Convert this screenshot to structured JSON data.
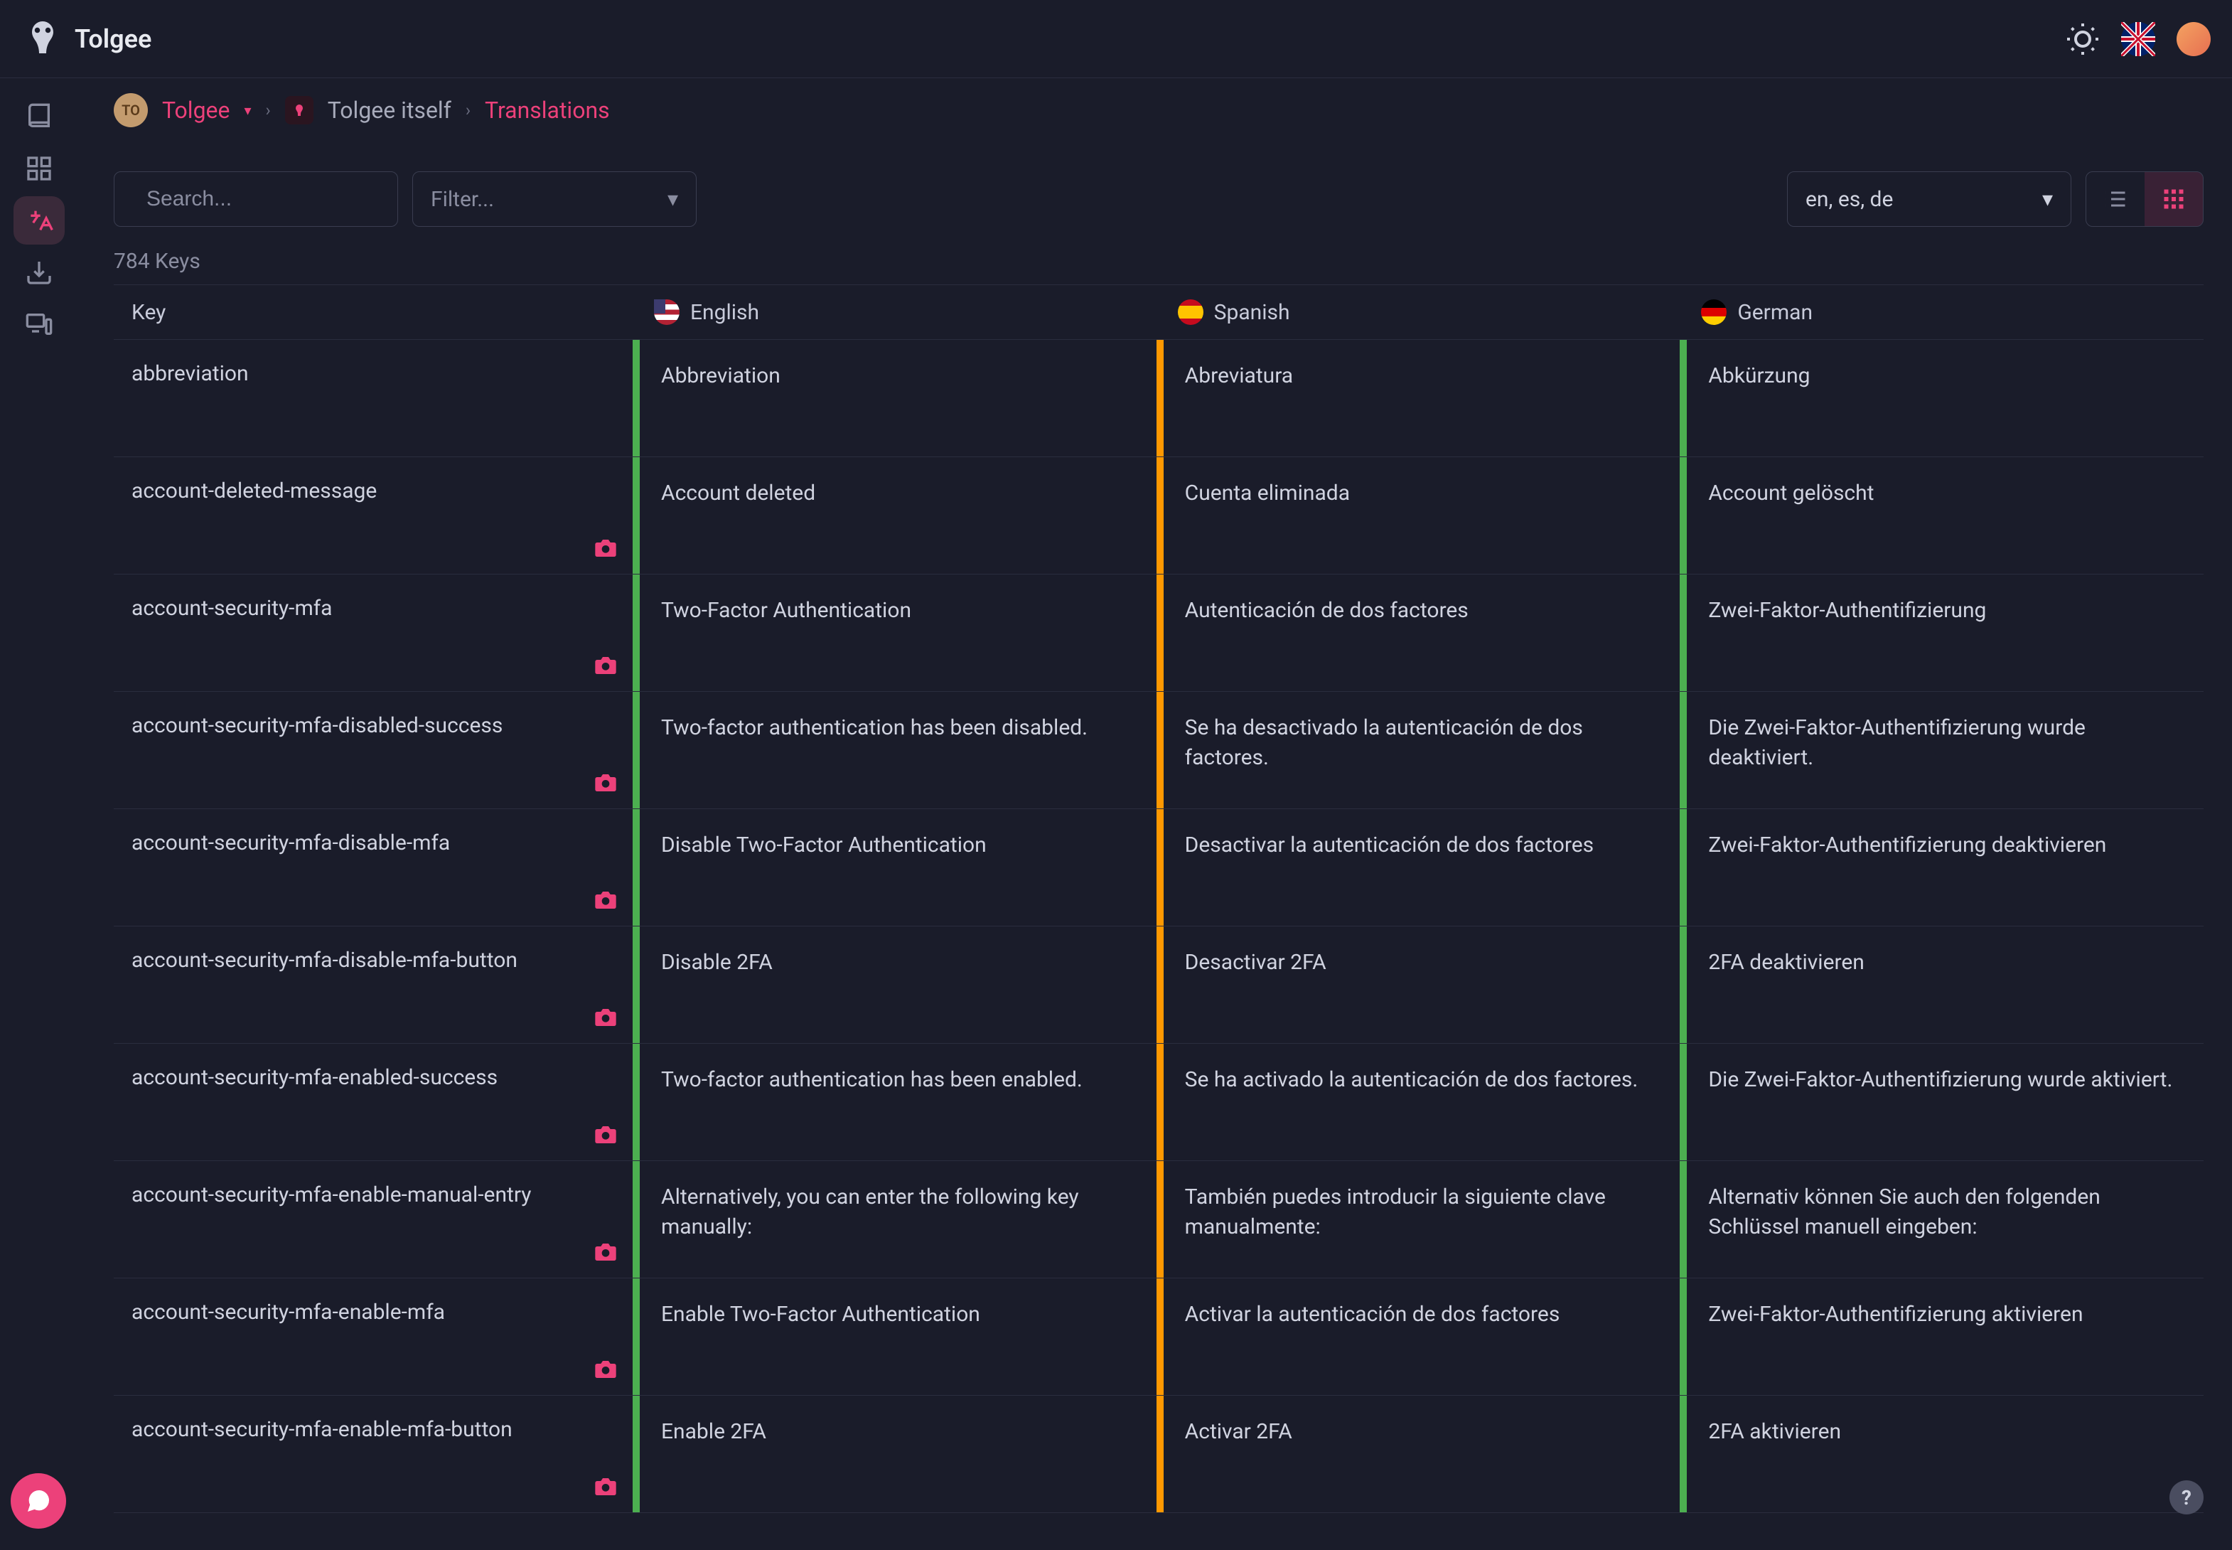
{
  "header": {
    "app_name": "Tolgee"
  },
  "breadcrumb": {
    "org_badge": "TO",
    "org_name": "Tolgee",
    "project_name": "Tolgee itself",
    "page": "Translations"
  },
  "toolbar": {
    "search_placeholder": "Search...",
    "filter_label": "Filter...",
    "lang_select": "en, es, de"
  },
  "keys_count": "784 Keys",
  "columns": {
    "key": "Key",
    "english": "English",
    "spanish": "Spanish",
    "german": "German"
  },
  "rows": [
    {
      "key": "abbreviation",
      "en": "Abbreviation",
      "es": "Abreviatura",
      "de": "Abkürzung",
      "en_status": "green",
      "es_status": "yellow",
      "de_status": "green",
      "screenshot": false
    },
    {
      "key": "account-deleted-message",
      "en": "Account deleted",
      "es": "Cuenta eliminada",
      "de": "Account gelöscht",
      "en_status": "green",
      "es_status": "yellow",
      "de_status": "green",
      "screenshot": true
    },
    {
      "key": "account-security-mfa",
      "en": "Two-Factor Authentication",
      "es": "Autenticación de dos factores",
      "de": "Zwei-Faktor-Authentifizierung",
      "en_status": "green",
      "es_status": "yellow",
      "de_status": "green",
      "screenshot": true
    },
    {
      "key": "account-security-mfa-disabled-success",
      "en": "Two-factor authentication has been disabled.",
      "es": "Se ha desactivado la autenticación de dos factores.",
      "de": "Die Zwei-Faktor-Authentifizierung wurde deaktiviert.",
      "en_status": "green",
      "es_status": "yellow",
      "de_status": "green",
      "screenshot": true
    },
    {
      "key": "account-security-mfa-disable-mfa",
      "en": "Disable Two-Factor Authentication",
      "es": "Desactivar la autenticación de dos factores",
      "de": "Zwei-Faktor-Authentifizierung deaktivieren",
      "en_status": "green",
      "es_status": "yellow",
      "de_status": "green",
      "screenshot": true
    },
    {
      "key": "account-security-mfa-disable-mfa-button",
      "en": "Disable 2FA",
      "es": "Desactivar 2FA",
      "de": "2FA deaktivieren",
      "en_status": "green",
      "es_status": "yellow",
      "de_status": "green",
      "screenshot": true
    },
    {
      "key": "account-security-mfa-enabled-success",
      "en": "Two-factor authentication has been enabled.",
      "es": "Se ha activado la autenticación de dos factores.",
      "de": "Die Zwei-Faktor-Authentifizierung wurde aktiviert.",
      "en_status": "green",
      "es_status": "yellow",
      "de_status": "green",
      "screenshot": true
    },
    {
      "key": "account-security-mfa-enable-manual-entry",
      "en": "Alternatively, you can enter the following key manually:",
      "es": "También puedes introducir la siguiente clave manualmente:",
      "de": "Alternativ können Sie auch den folgenden Schlüssel manuell eingeben:",
      "en_status": "green",
      "es_status": "yellow",
      "de_status": "green",
      "screenshot": true
    },
    {
      "key": "account-security-mfa-enable-mfa",
      "en": "Enable Two-Factor Authentication",
      "es": "Activar la autenticación de dos factores",
      "de": "Zwei-Faktor-Authentifizierung aktivieren",
      "en_status": "green",
      "es_status": "yellow",
      "de_status": "green",
      "screenshot": true
    },
    {
      "key": "account-security-mfa-enable-mfa-button",
      "en": "Enable 2FA",
      "es": "Activar 2FA",
      "de": "2FA aktivieren",
      "en_status": "green",
      "es_status": "yellow",
      "de_status": "green",
      "screenshot": true
    }
  ],
  "colors": {
    "accent": "#ec417a",
    "bg": "#1a1c2a",
    "status_green": "#4caf50",
    "status_yellow": "#ff9800"
  }
}
